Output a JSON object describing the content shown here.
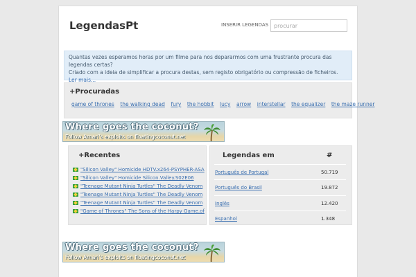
{
  "header": {
    "brand": "LegendasPt",
    "insert_link": "INSERIR LEGENDAS",
    "search_placeholder": "procurar"
  },
  "info": {
    "line1": "Quantas vezes esperamos horas por um filme para nos depararmos com uma frustrante procura das legendas certas?",
    "line2": "Criado com a ideia de simplificar a procura destas, sem registo obrigatório ou compressão de ficheiros.",
    "more_link": "Ler mais..."
  },
  "popular": {
    "title": "+Procuradas",
    "tags": [
      "game of thrones",
      "the walking dead",
      "fury",
      "the hobbit",
      "lucy",
      "arrow",
      "interstellar",
      "the equalizer",
      "the maze runner"
    ]
  },
  "banner": {
    "line1": "Where goes the coconut?",
    "line2": "Follow Arnari's exploits on floatingcoconut.net"
  },
  "recent": {
    "title": "+Recentes",
    "items": [
      "\"Silicon Valley\" Homicide HDTV.x264-PSYPHER-ASA",
      "\"Silicon Valley\" Homicide Silicon.Valley.S02E06",
      "\"Teenage Mutant Ninja Turtles\" The Deadly Venom",
      "\"Teenage Mutant Ninja Turtles\" The Deadly Venom",
      "\"Teenage Mutant Ninja Turtles\" The Deadly Venom",
      "\"Game of Thrones\" The Sons of the Harpy Game.of"
    ]
  },
  "languages": {
    "title": "Legendas em",
    "count_header": "#",
    "rows": [
      {
        "name": "Português de Portugal",
        "count": "50.719"
      },
      {
        "name": "Português do Brasil",
        "count": "19.872"
      },
      {
        "name": "Inglês",
        "count": "12.420"
      },
      {
        "name": "Espanhol",
        "count": "1.348"
      }
    ]
  },
  "colors": {
    "link": "#3a6fb0",
    "info_bg": "#e1edf8",
    "panel_bg": "#ececec"
  }
}
